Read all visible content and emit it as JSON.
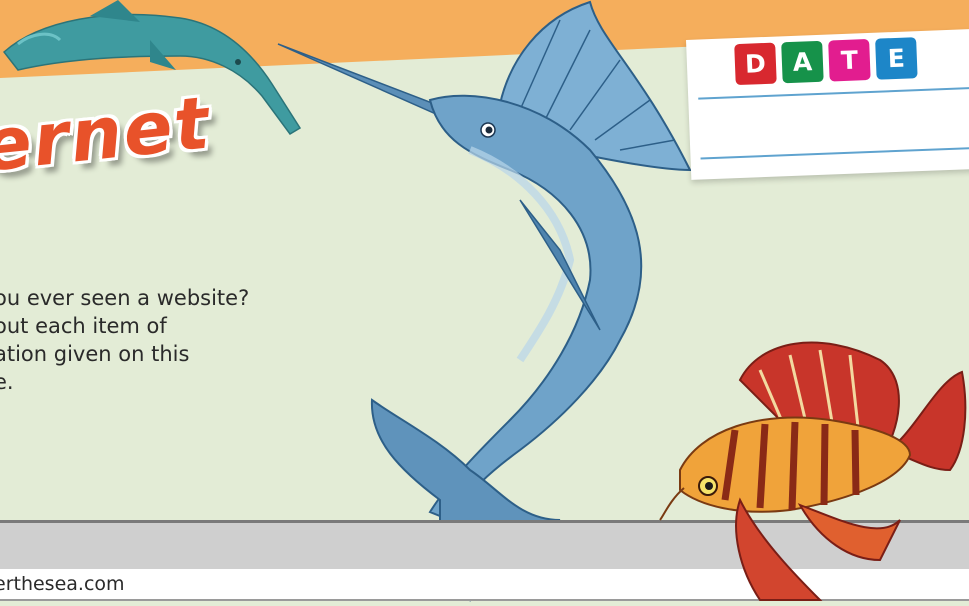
{
  "header": {
    "title_fragment": "ernet"
  },
  "date_card": {
    "letters": [
      {
        "char": "D",
        "color": "#d8282f"
      },
      {
        "char": "A",
        "color": "#16924a"
      },
      {
        "char": "T",
        "color": "#e21d8f"
      },
      {
        "char": "E",
        "color": "#1d86c8"
      }
    ]
  },
  "intro": {
    "lines": [
      "ou ever seen a website?",
      "out each item of",
      "ation given on this",
      "e."
    ]
  },
  "address_bar": {
    "url": "erthesea.com"
  },
  "illustrations": [
    "sawfish",
    "sailfish",
    "lionfish"
  ],
  "colors": {
    "top_banner": "#f5ae5c",
    "background": "#e3ecd6",
    "title": "#e8522a"
  }
}
